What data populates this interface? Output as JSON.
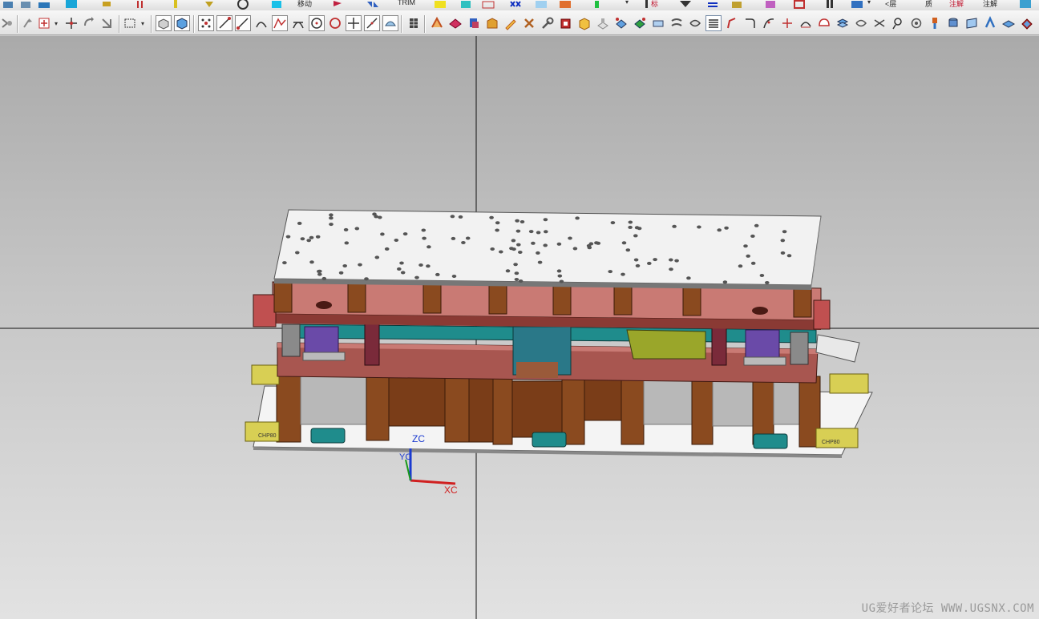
{
  "toolbar_top": {
    "labels": {
      "move": "移动",
      "trim": "TRIM",
      "biao": "标",
      "ceng": "<层",
      "zhi": "质",
      "zhujie1": "注解",
      "zhujie2": "注解"
    }
  },
  "toolbar_main": {
    "icons": [
      "snap-icon",
      "point-icon",
      "move-icon",
      "rotate-icon",
      "select-box-icon",
      "dropdown-icon",
      "shaded-view-icon",
      "wireframe-icon",
      "point-grid-icon",
      "line-icon",
      "arc-line-icon",
      "spline-icon",
      "polyline-icon",
      "tangent-icon",
      "circle-center-icon",
      "circle-icon",
      "plus-icon",
      "slash-icon",
      "shell-icon",
      "grid-icon",
      "feature-icon",
      "face-icon",
      "blend-icon",
      "pencil-icon",
      "tools-icon",
      "box-icon",
      "cube-icon",
      "stamp-icon",
      "edge-icon",
      "surface-icon",
      "trim-icon",
      "offset-icon",
      "shape-icon",
      "layers-icon",
      "table-icon",
      "bend-icon",
      "corner-icon",
      "curve-icon",
      "cross-icon",
      "sweep-icon",
      "blob-icon",
      "stack-icon",
      "swirl-icon",
      "sphere-icon",
      "pin-icon",
      "cylinder-icon",
      "gear-icon",
      "sheet-icon",
      "rotate-view-icon",
      "eraser-icon"
    ]
  },
  "viewport": {
    "axes": {
      "zc": "ZC",
      "yc": "YC",
      "xc": "XC"
    },
    "plate_labels": {
      "left": "CHP80",
      "right": "CHP80"
    },
    "watermark": "UG爱好者论坛 WWW.UGSNX.COM"
  },
  "colors": {
    "top_plate": "#f2f2f2",
    "wood": "#8a4a1f",
    "pink_plate": "#c97a74",
    "teal": "#1f8c8c",
    "yellow_block": "#d8cf54",
    "purple": "#6a4aa8",
    "olive": "#9aa62a",
    "axis_x": "#d02020",
    "axis_y": "#1a9a1a",
    "axis_z": "#1a3ad0"
  }
}
